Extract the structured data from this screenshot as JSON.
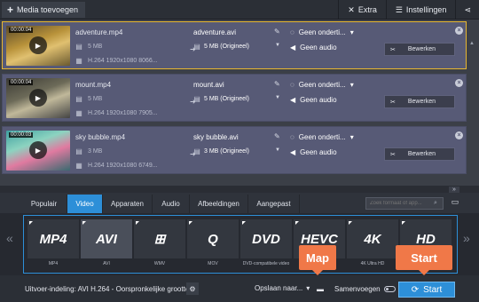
{
  "toolbar": {
    "add_media": "Media toevoegen",
    "extra": "Extra",
    "settings": "Instellingen"
  },
  "files": [
    {
      "time": "00:00:04",
      "src_name": "adventure.mp4",
      "src_size": "5 MB",
      "src_codec": "H.264 1920x1080 8066...",
      "dst_name": "adventure.avi",
      "dst_size": "5 MB (Origineel)",
      "subtitles": "Geen onderti...",
      "audio": "Geen audio",
      "edit": "Bewerken"
    },
    {
      "time": "00:00:04",
      "src_name": "mount.mp4",
      "src_size": "5 MB",
      "src_codec": "H.264 1920x1080 7905...",
      "dst_name": "mount.avi",
      "dst_size": "5 MB (Origineel)",
      "subtitles": "Geen onderti...",
      "audio": "Geen audio",
      "edit": "Bewerken"
    },
    {
      "time": "00:00:03",
      "src_name": "sky bubble.mp4",
      "src_size": "3 MB",
      "src_codec": "H.264 1920x1080 6749...",
      "dst_name": "sky bubble.avi",
      "dst_size": "3 MB (Origineel)",
      "subtitles": "Geen onderti...",
      "audio": "Geen audio",
      "edit": "Bewerken"
    }
  ],
  "tabs": [
    "Populair",
    "Video",
    "Apparaten",
    "Audio",
    "Afbeeldingen",
    "Aangepast"
  ],
  "active_tab": "Video",
  "search_placeholder": "Zoek formaat of app...",
  "formats": [
    {
      "logo": "MP4",
      "caption": "MP4"
    },
    {
      "logo": "AVI",
      "caption": "AVI"
    },
    {
      "logo": "⊞",
      "caption": "WMV"
    },
    {
      "logo": "Q",
      "caption": "MOV"
    },
    {
      "logo": "DVD",
      "caption": "DVD-compatibele video"
    },
    {
      "logo": "HEVC",
      "caption": "HEVC"
    },
    {
      "logo": "4K",
      "caption": "4K Ultra HD"
    },
    {
      "logo": "HD",
      "caption": "HD"
    }
  ],
  "bottom": {
    "output_format": "Uitvoer-indeling: AVI H.264 - Oorspronkelijke grootte",
    "save_as": "Opslaan naar...",
    "merge": "Samenvoegen",
    "start": "Start"
  },
  "callouts": {
    "map": "Map",
    "start": "Start"
  },
  "colors": {
    "accent": "#2d8fd8",
    "callout": "#f07848",
    "selection": "#e8b730"
  }
}
